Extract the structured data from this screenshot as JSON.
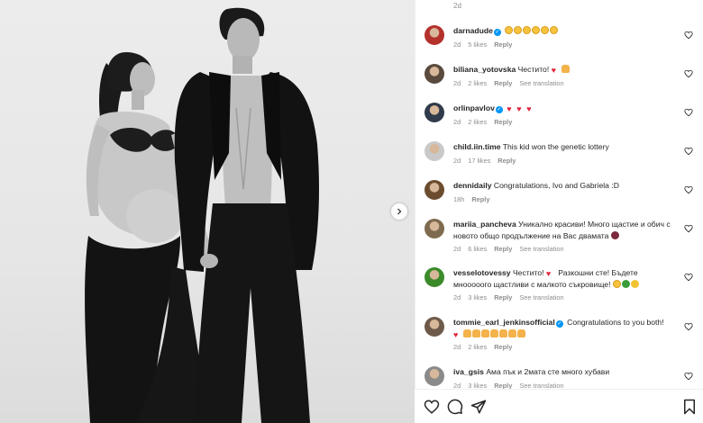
{
  "post": {
    "top_time": "2d",
    "colors": {
      "verified": "#0095f6",
      "text": "#262626",
      "muted": "#8e8e8e",
      "heart": "#e0263c"
    }
  },
  "comments": [
    {
      "user": "darnadude",
      "verified": true,
      "text": "",
      "emojis": [
        "face",
        "face",
        "face",
        "face",
        "face",
        "face"
      ],
      "time": "2d",
      "likes": "5 likes",
      "reply": "Reply",
      "see_translation": ""
    },
    {
      "user": "biliana_yotovska",
      "verified": false,
      "text": "Честито!",
      "emojis": [
        "heartred",
        "hands"
      ],
      "time": "2d",
      "likes": "2 likes",
      "reply": "Reply",
      "see_translation": "See translation"
    },
    {
      "user": "orlinpavlov",
      "verified": true,
      "text": "",
      "emojis": [
        "heartred",
        "heartred",
        "heartred"
      ],
      "time": "2d",
      "likes": "2 likes",
      "reply": "Reply",
      "see_translation": ""
    },
    {
      "user": "child.iin.time",
      "verified": false,
      "text": "This kid won the genetic lottery",
      "emojis": [],
      "time": "2d",
      "likes": "17 likes",
      "reply": "Reply",
      "see_translation": ""
    },
    {
      "user": "dennidaily",
      "verified": false,
      "text": "Congratulations, Ivo and Gabriela :D",
      "emojis": [],
      "time": "18h",
      "likes": "",
      "reply": "Reply",
      "see_translation": ""
    },
    {
      "user": "mariia_pancheva",
      "verified": false,
      "text": "Уникално красиви! Много щастие и обич с новото общо продължение на Вас двамата",
      "emojis": [
        "plum"
      ],
      "time": "2d",
      "likes": "6 likes",
      "reply": "Reply",
      "see_translation": "See translation"
    },
    {
      "user": "vesselotovessy",
      "verified": false,
      "text": "Честито!",
      "text2": "Разкошни сте! Бъдете мнооооого щастливи с малкото съкровище!",
      "emojis_mid": [
        "heartred"
      ],
      "emojis": [
        "face",
        "clover",
        "sun"
      ],
      "time": "2d",
      "likes": "3 likes",
      "reply": "Reply",
      "see_translation": "See translation"
    },
    {
      "user": "tommie_earl_jenkinsofficial",
      "verified": true,
      "text": "Congratulations to you both!",
      "emojis": [
        "heartred",
        "hands",
        "hands",
        "hands",
        "hands",
        "hands",
        "hands",
        "hands"
      ],
      "time": "2d",
      "likes": "2 likes",
      "reply": "Reply",
      "see_translation": ""
    },
    {
      "user": "iva_gsis",
      "verified": false,
      "text": "Ама пък и 2мата сте много хубави",
      "emojis": [],
      "time": "2d",
      "likes": "3 likes",
      "reply": "Reply",
      "see_translation": "See translation"
    }
  ],
  "icons": {
    "next": "chevron-right-icon",
    "like": "heart-icon",
    "comment": "comment-icon",
    "share": "share-icon",
    "save": "bookmark-icon"
  }
}
